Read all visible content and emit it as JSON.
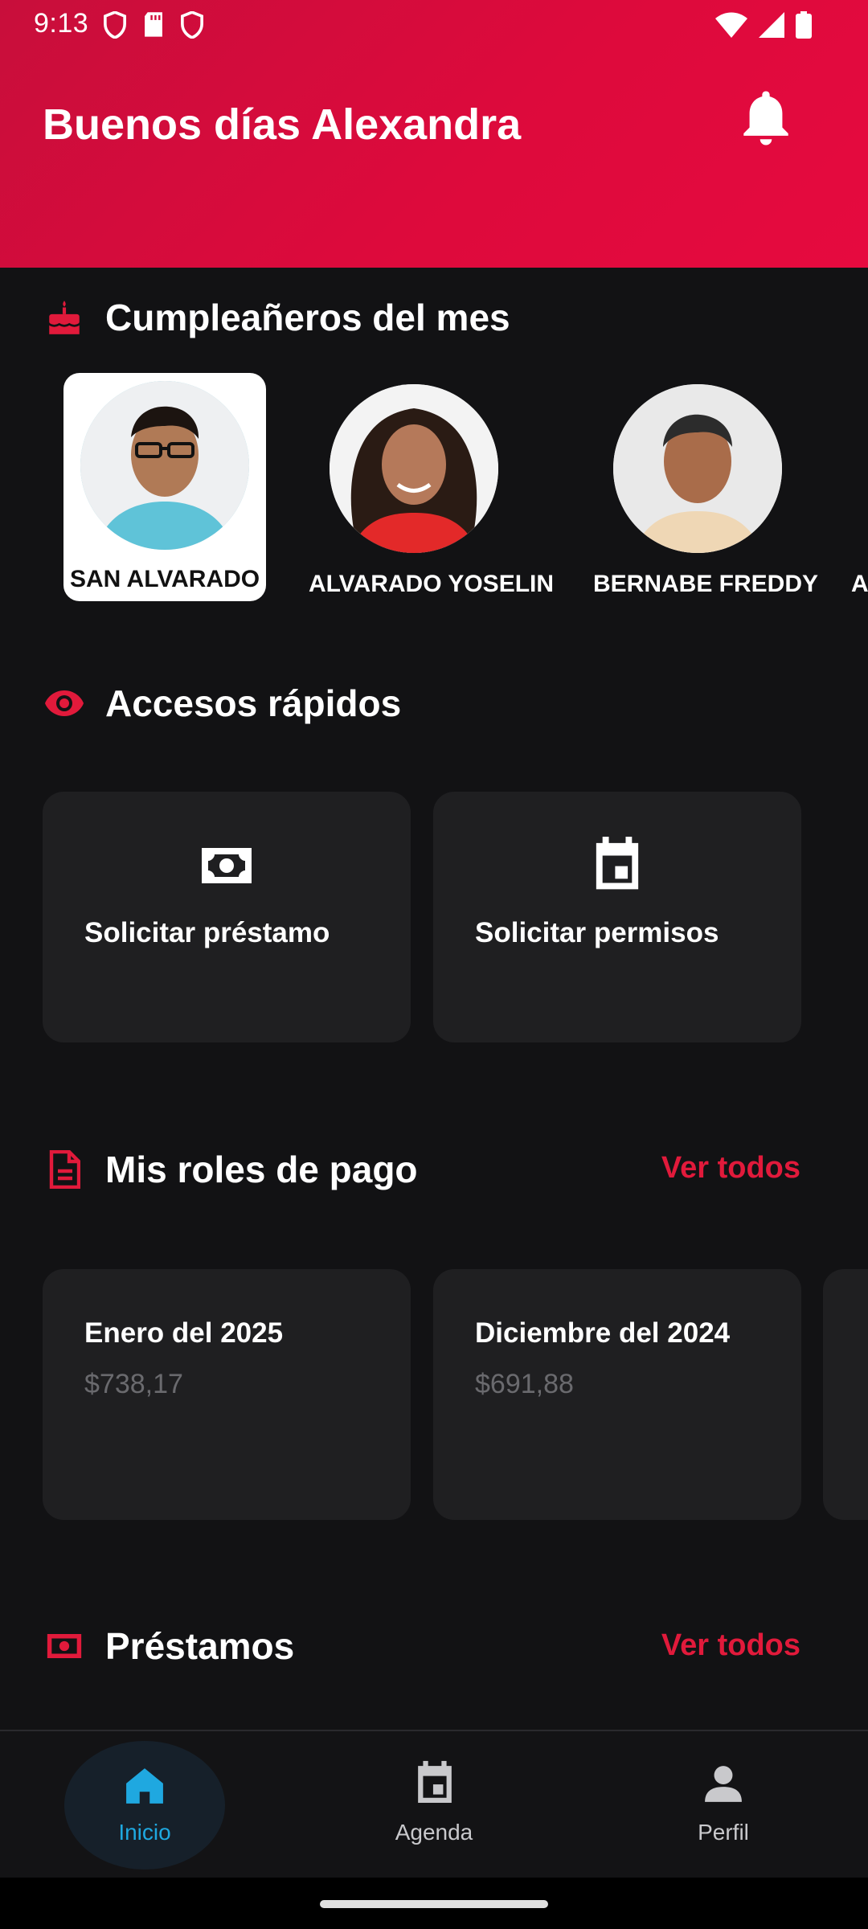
{
  "status": {
    "time": "9:13"
  },
  "header": {
    "greeting": "Buenos días Alexandra"
  },
  "birthdays": {
    "title": "Cumpleañeros del mes",
    "people": [
      {
        "name": "SAN ALVARADO"
      },
      {
        "name": "ALVARADO YOSELIN"
      },
      {
        "name": "BERNABE FREDDY"
      },
      {
        "name": "A"
      }
    ]
  },
  "quick_access": {
    "title": "Accesos rápidos",
    "items": [
      {
        "label": "Solicitar préstamo",
        "icon": "money-icon"
      },
      {
        "label": "Solicitar permisos",
        "icon": "calendar-icon"
      }
    ]
  },
  "payroll": {
    "title": "Mis roles de pago",
    "see_all": "Ver todos",
    "items": [
      {
        "period": "Enero del 2025",
        "amount": "$738,17"
      },
      {
        "period": "Diciembre del 2024",
        "amount": "$691,88"
      }
    ]
  },
  "loans": {
    "title": "Préstamos",
    "see_all": "Ver todos"
  },
  "nav": {
    "items": [
      {
        "label": "Inicio",
        "icon": "home-icon",
        "active": true
      },
      {
        "label": "Agenda",
        "icon": "calendar-icon",
        "active": false
      },
      {
        "label": "Perfil",
        "icon": "person-icon",
        "active": false
      }
    ]
  },
  "colors": {
    "accent": "#e11a3b",
    "header": "#dd0a3c",
    "nav_active": "#1fa8e0",
    "background": "#121214",
    "card": "#1f1f21"
  }
}
